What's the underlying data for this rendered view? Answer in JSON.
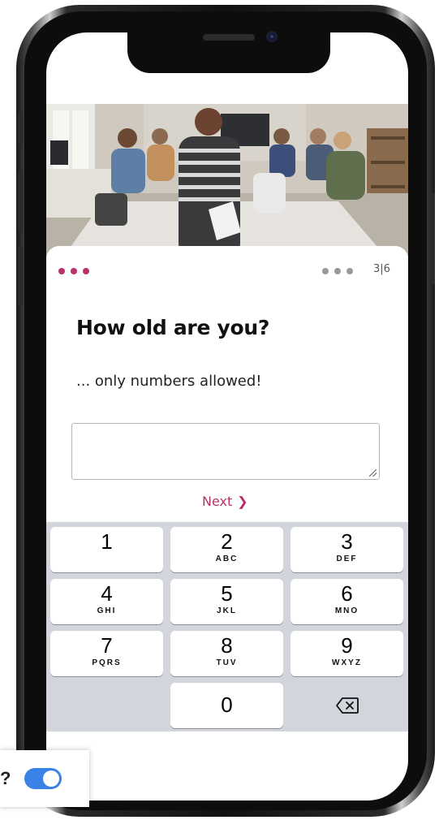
{
  "progress": {
    "step_label": "3|6",
    "active_color": "#b5326b",
    "inactive_color": "#999999"
  },
  "question": {
    "title": "How old are you?",
    "hint": "... only numbers allowed!",
    "answer_value": ""
  },
  "next": {
    "label": "Next",
    "icon": "chevron-right-icon"
  },
  "keypad": {
    "keys": [
      {
        "num": "1",
        "letters": ""
      },
      {
        "num": "2",
        "letters": "ABC"
      },
      {
        "num": "3",
        "letters": "DEF"
      },
      {
        "num": "4",
        "letters": "GHI"
      },
      {
        "num": "5",
        "letters": "JKL"
      },
      {
        "num": "6",
        "letters": "MNO"
      },
      {
        "num": "7",
        "letters": "PQRS"
      },
      {
        "num": "8",
        "letters": "TUV"
      },
      {
        "num": "9",
        "letters": "WXYZ"
      },
      {
        "num": "0",
        "letters": ""
      }
    ],
    "backspace_icon": "backspace-icon"
  },
  "toggle": {
    "label": "?",
    "on": true,
    "color": "#3b82e6"
  }
}
